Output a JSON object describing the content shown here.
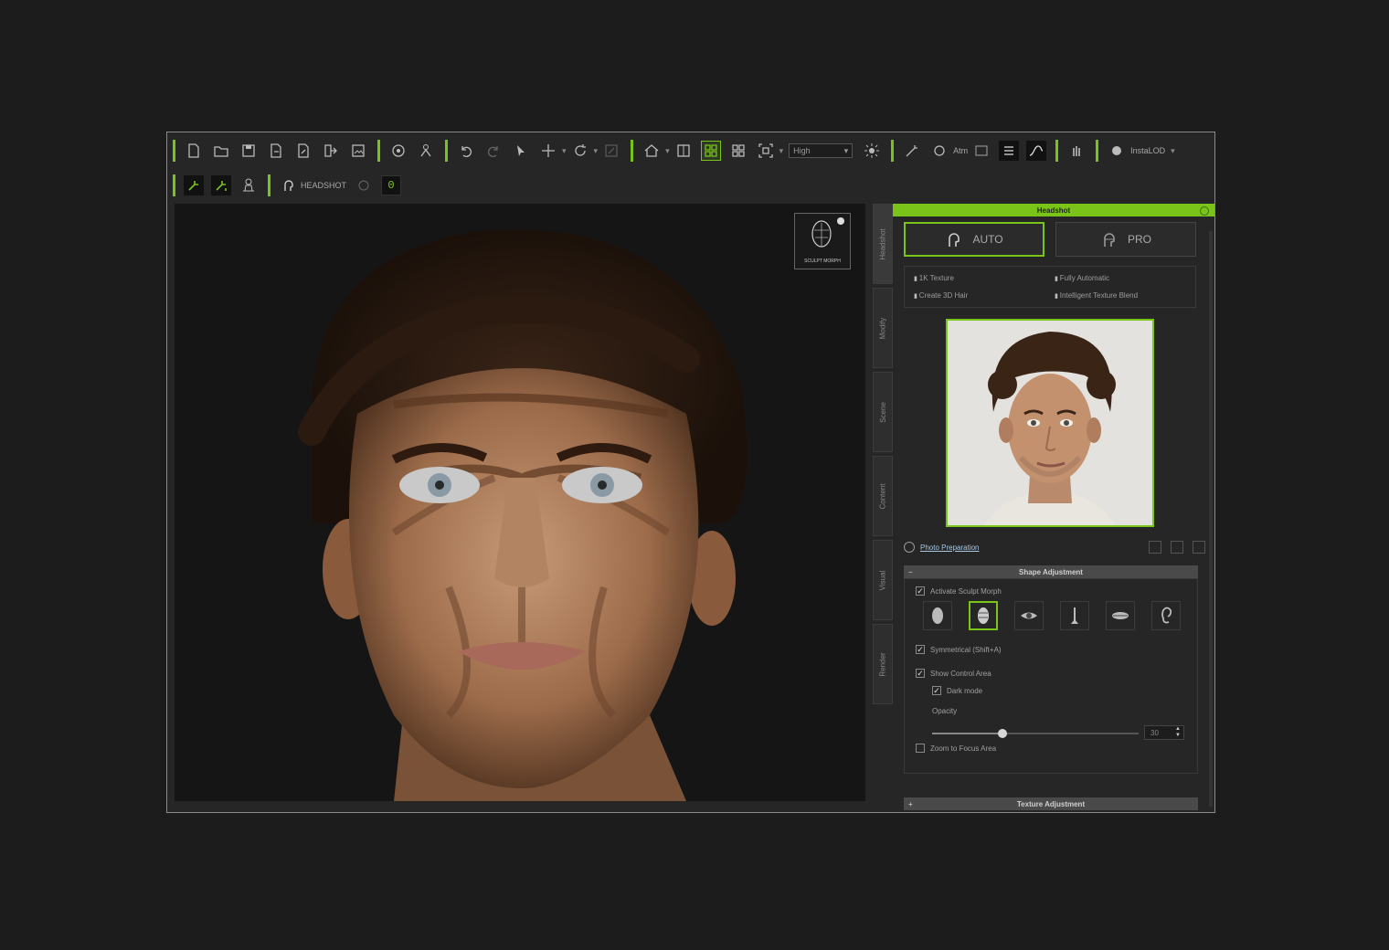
{
  "toolbar": {
    "quality_combo": "High",
    "atm_label": "Atm",
    "instalod_label": "InstaLOD",
    "headshot_label": "HEADSHOT",
    "counter_value": "0"
  },
  "viewport": {
    "sculpt_badge_label": "SCULPT MORPH"
  },
  "side_tabs": [
    "Headshot",
    "Modify",
    "Scene",
    "Content",
    "Visual",
    "Render"
  ],
  "panel": {
    "title": "Headshot",
    "mode_auto": "AUTO",
    "mode_pro": "PRO",
    "features": [
      "1K Texture",
      "Fully Automatic",
      "Create 3D Hair",
      "Intelligent Texture Blend"
    ],
    "photo_prep_link": "Photo Preparation",
    "shape_section": "Shape Adjustment",
    "shape_section_sign": "−",
    "activate_sculpt": "Activate Sculpt Morph",
    "symmetrical": "Symmetrical (Shift+A)",
    "show_control": "Show Control Area",
    "dark_mode": "Dark mode",
    "opacity_label": "Opacity",
    "opacity_value": "30",
    "opacity_fraction": 0.34,
    "zoom_focus": "Zoom to Focus Area",
    "texture_section": "Texture Adjustment",
    "texture_section_sign": "+"
  },
  "colors": {
    "accent": "#7ac41a",
    "background": "#1c1c1c",
    "window": "#262626"
  }
}
